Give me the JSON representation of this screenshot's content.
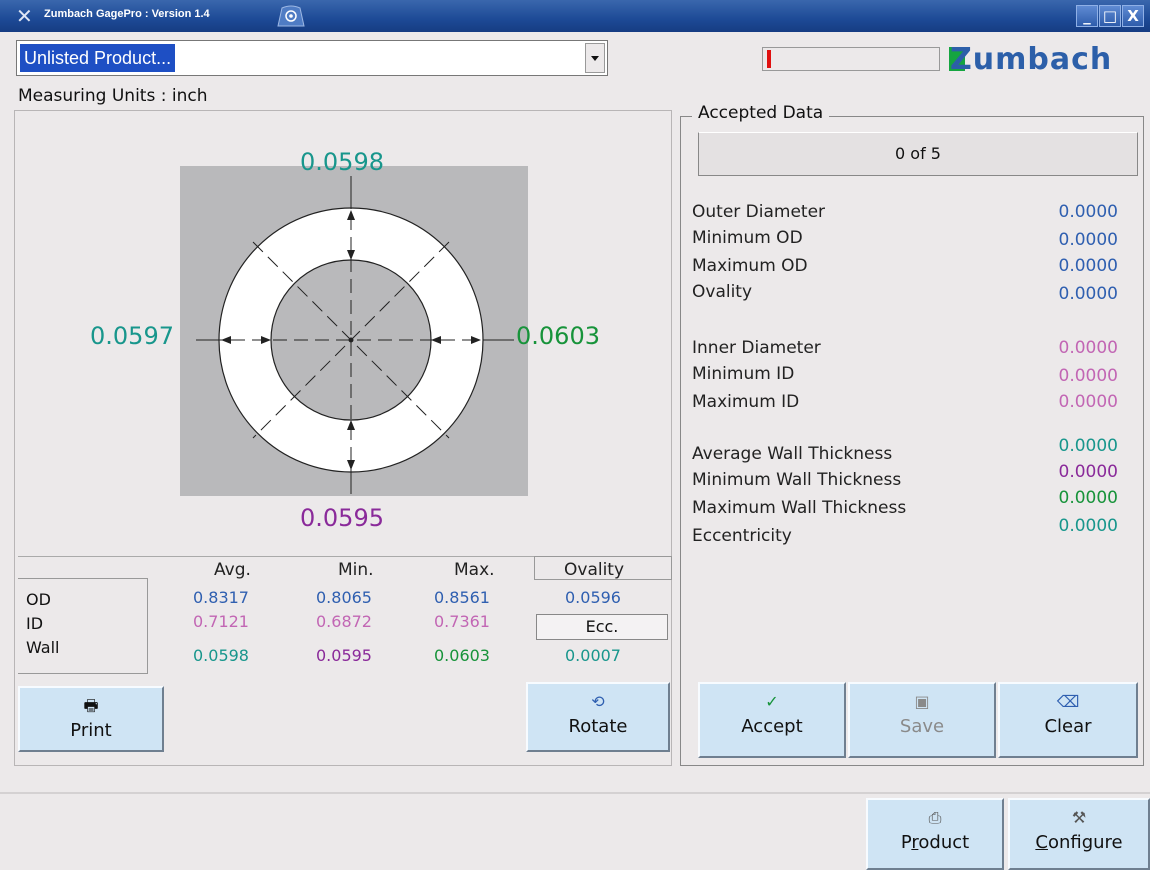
{
  "window": {
    "title": "Zumbach GagePro : Version 1.4",
    "min_glyph": "_",
    "max_glyph": "□",
    "close_glyph": "X"
  },
  "product_select": {
    "value": "Unlisted Product..."
  },
  "logo": {
    "text": "Zumbach"
  },
  "units": {
    "label": "Measuring Units : inch"
  },
  "gauge": {
    "top_value": "0.0598",
    "left_value": "0.0597",
    "right_value": "0.0603",
    "bottom_value": "0.0595"
  },
  "table": {
    "headers": [
      "Avg.",
      "Min.",
      "Max.",
      "Ovality"
    ],
    "rows": [
      {
        "label": "OD",
        "avg": "0.8317",
        "min": "0.8065",
        "max": "0.8561",
        "extra": "0.0596"
      },
      {
        "label": "ID",
        "avg": "0.7121",
        "min": "0.6872",
        "max": "0.7361",
        "extra": "Ecc."
      },
      {
        "label": "Wall",
        "avg": "0.0598",
        "min": "0.0595",
        "max": "0.0603",
        "extra": "0.0007"
      }
    ]
  },
  "buttons": {
    "print": "Print",
    "rotate": "Rotate",
    "accept": "Accept",
    "save": "Save",
    "clear": "Clear",
    "product_prefix": "P",
    "product_underline": "r",
    "product_suffix": "oduct",
    "configure_underline": "C",
    "configure_suffix": "onfigure"
  },
  "accepted": {
    "legend": "Accepted Data",
    "counter": "0 of 5",
    "stats": [
      {
        "label": "Outer Diameter",
        "value": "0.0000"
      },
      {
        "label": "Minimum OD",
        "value": "0.0000"
      },
      {
        "label": "Maximum OD",
        "value": "0.0000"
      },
      {
        "label": "Ovality",
        "value": "0.0000"
      },
      {
        "label": "Inner Diameter",
        "value": "0.0000"
      },
      {
        "label": "Minimum ID",
        "value": "0.0000"
      },
      {
        "label": "Maximum ID",
        "value": "0.0000"
      },
      {
        "label": "Average Wall Thickness",
        "value": "0.0000"
      },
      {
        "label": "Minimum Wall Thickness",
        "value": "0.0000"
      },
      {
        "label": "Maximum Wall Thickness",
        "value": "0.0000"
      },
      {
        "label": "Eccentricity",
        "value": "0.0000"
      }
    ]
  },
  "colors": {
    "od_blue": "#2f5fb0",
    "id_pink": "#c266b4",
    "wall_teal": "#18968c",
    "wall_purple": "#8a2a9a",
    "wall_green": "#17933a",
    "title_bar": "#1d4a96",
    "button_bg": "#cfe4f4"
  },
  "icons": {
    "print": "printer-icon",
    "rotate": "rotate-icon",
    "accept": "checkmark-icon",
    "save": "floppy-disk-icon",
    "clear": "eraser-icon",
    "product": "product-icon",
    "configure": "configure-tools-icon"
  }
}
